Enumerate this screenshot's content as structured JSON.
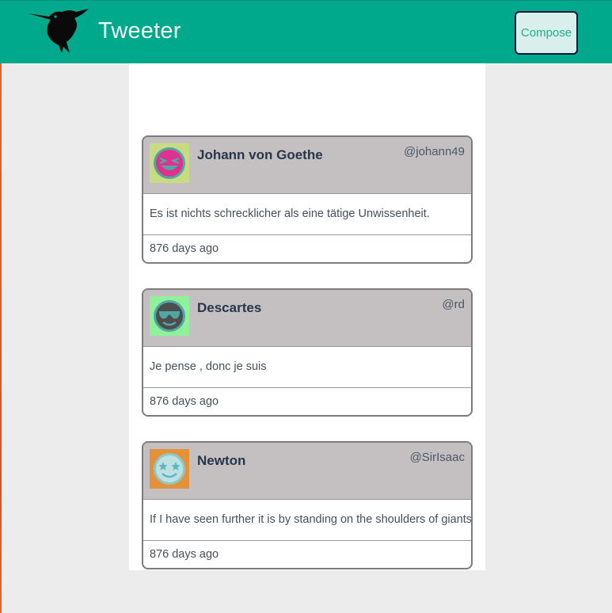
{
  "nav": {
    "brand": "Tweeter",
    "compose_label": "Compose",
    "logo_icon": "hummingbird-icon"
  },
  "tweets": [
    {
      "name": "Johann von Goethe",
      "handle": "@johann49",
      "text": "Es ist nichts schrecklicher als eine tätige Unwissenheit.",
      "time": "876 days ago",
      "avatar_icon": "laughing-face-icon",
      "avatar_bg": "#c7dc80",
      "avatar_face": "#e0318e"
    },
    {
      "name": "Descartes",
      "handle": "@rd",
      "text": "Je pense , donc je suis",
      "time": "876 days ago",
      "avatar_icon": "sunglasses-face-icon",
      "avatar_bg": "#8ff29a",
      "avatar_face": "#4d4d4d"
    },
    {
      "name": "Newton",
      "handle": "@SirIsaac",
      "text": "If I have seen further it is by standing on the shoulders of giants",
      "time": "876 days ago",
      "avatar_icon": "star-eyes-face-icon",
      "avatar_bg": "#e4923a",
      "avatar_face": "#bde1e0"
    }
  ]
}
